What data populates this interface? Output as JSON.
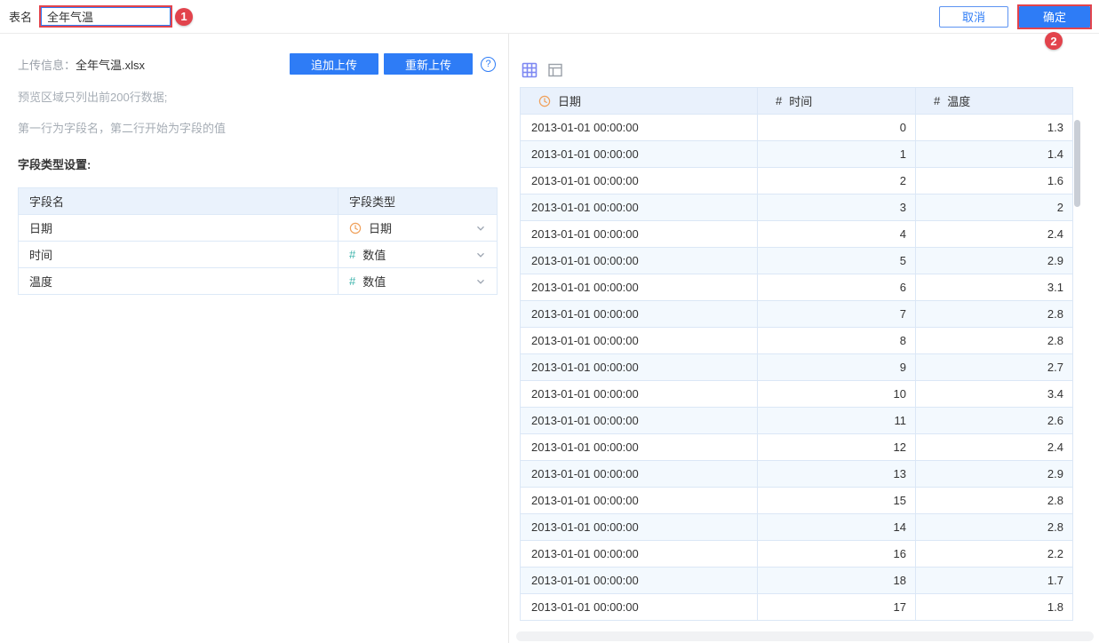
{
  "topbar": {
    "table_name_label": "表名",
    "table_name_value": "全年气温",
    "cancel_label": "取消",
    "confirm_label": "确定",
    "annotation_badge_1": "1",
    "annotation_badge_2": "2"
  },
  "left_panel": {
    "upload_info_label": "上传信息：",
    "upload_file_name": "全年气温.xlsx",
    "append_upload_label": "追加上传",
    "reupload_label": "重新上传",
    "help_icon_glyph": "?",
    "hint_line1": "预览区域只列出前200行数据;",
    "hint_line2": "第一行为字段名，第二行开始为字段的值",
    "field_type_settings_label": "字段类型设置:",
    "field_table": {
      "name_header": "字段名",
      "type_header": "字段类型",
      "rows": [
        {
          "name": "日期",
          "type_label": "日期",
          "type_icon": "clock-icon"
        },
        {
          "name": "时间",
          "type_label": "数值",
          "type_icon": "number-icon"
        },
        {
          "name": "温度",
          "type_label": "数值",
          "type_icon": "number-icon"
        }
      ]
    }
  },
  "preview_panel": {
    "view_icons": [
      "grid-view-icon",
      "panel-view-icon"
    ],
    "table": {
      "columns": [
        {
          "label": "日期",
          "icon": "clock-icon"
        },
        {
          "label": "时间",
          "icon": "number-icon"
        },
        {
          "label": "温度",
          "icon": "number-icon"
        }
      ],
      "rows": [
        [
          "2013-01-01 00:00:00",
          "0",
          "1.3"
        ],
        [
          "2013-01-01 00:00:00",
          "1",
          "1.4"
        ],
        [
          "2013-01-01 00:00:00",
          "2",
          "1.6"
        ],
        [
          "2013-01-01 00:00:00",
          "3",
          "2"
        ],
        [
          "2013-01-01 00:00:00",
          "4",
          "2.4"
        ],
        [
          "2013-01-01 00:00:00",
          "5",
          "2.9"
        ],
        [
          "2013-01-01 00:00:00",
          "6",
          "3.1"
        ],
        [
          "2013-01-01 00:00:00",
          "7",
          "2.8"
        ],
        [
          "2013-01-01 00:00:00",
          "8",
          "2.8"
        ],
        [
          "2013-01-01 00:00:00",
          "9",
          "2.7"
        ],
        [
          "2013-01-01 00:00:00",
          "10",
          "3.4"
        ],
        [
          "2013-01-01 00:00:00",
          "11",
          "2.6"
        ],
        [
          "2013-01-01 00:00:00",
          "12",
          "2.4"
        ],
        [
          "2013-01-01 00:00:00",
          "13",
          "2.9"
        ],
        [
          "2013-01-01 00:00:00",
          "15",
          "2.8"
        ],
        [
          "2013-01-01 00:00:00",
          "14",
          "2.8"
        ],
        [
          "2013-01-01 00:00:00",
          "16",
          "2.2"
        ],
        [
          "2013-01-01 00:00:00",
          "18",
          "1.7"
        ],
        [
          "2013-01-01 00:00:00",
          "17",
          "1.8"
        ]
      ]
    }
  },
  "colors": {
    "primary_blue": "#2e7cf6",
    "annotation_red": "#e2434c",
    "table_header_bg": "#e9f1fc",
    "table_stripe_bg": "#f3f9fe",
    "table_border": "#dbe7f6",
    "clock_icon_orange": "#f0a05a",
    "number_icon_teal": "#3bb3ab",
    "grid_view_icon_blue": "#7d88f2"
  }
}
